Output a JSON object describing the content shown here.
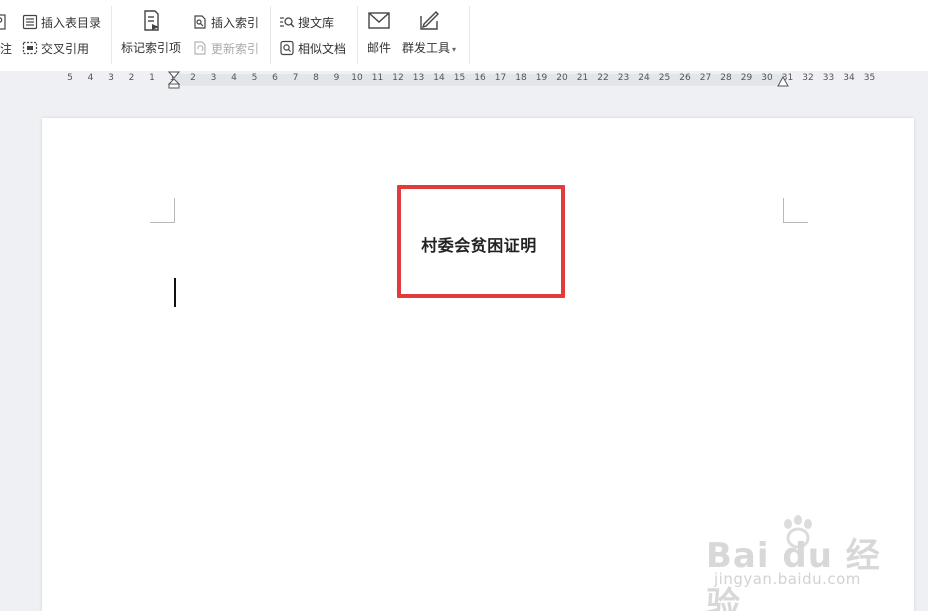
{
  "ribbon": {
    "insert_table_of_figures": "插入表目录",
    "footnote_fragment": "注",
    "cross_reference": "交叉引用",
    "mark_index_entry": "标记索引项",
    "insert_index": "插入索引",
    "update_index": "更新索引",
    "search_library": "搜文库",
    "similar_documents": "相似文档",
    "mail": "邮件",
    "mass_send_tools": "群发工具"
  },
  "ruler": {
    "labels": [
      "5",
      "4",
      "3",
      "2",
      "1",
      "1",
      "2",
      "3",
      "4",
      "5",
      "6",
      "7",
      "8",
      "9",
      "10",
      "11",
      "12",
      "13",
      "14",
      "15",
      "16",
      "17",
      "18",
      "19",
      "20",
      "21",
      "22",
      "23",
      "24",
      "25",
      "26",
      "27",
      "28",
      "29",
      "30",
      "31",
      "32",
      "33",
      "34",
      "35"
    ]
  },
  "document": {
    "title": "村委会贫困证明",
    "highlight_color": "#e23b3b"
  },
  "watermark": {
    "brand": "Bai du 经验",
    "site": "jingyan.baidu.com"
  },
  "colors": {
    "ribbon_bg": "#ffffff",
    "workspace_bg": "#eef0f3",
    "page_bg": "#ffffff"
  }
}
